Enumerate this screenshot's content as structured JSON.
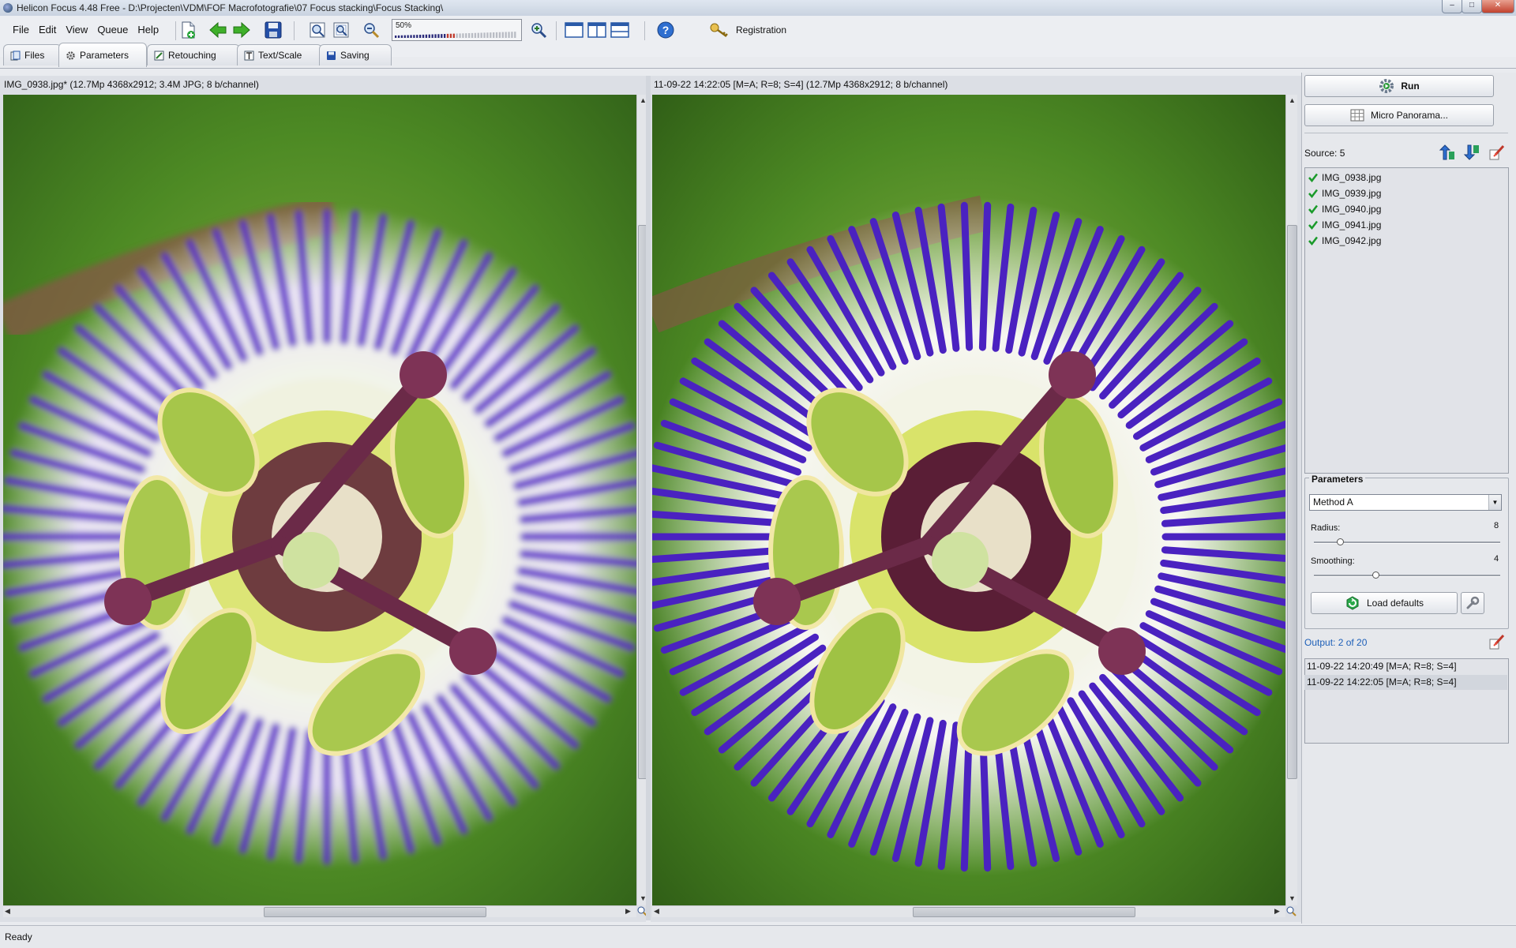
{
  "window": {
    "title": "Helicon Focus 4.48 Free - D:\\Projecten\\VDM\\FOF Macrofotografie\\07 Focus stacking\\Focus Stacking\\"
  },
  "menu": [
    "File",
    "Edit",
    "View",
    "Queue",
    "Help"
  ],
  "toolbar": {
    "zoom_value": "50%",
    "zoom_fraction": 0.5,
    "registration_label": "Registration"
  },
  "tabs": [
    {
      "label": "Files",
      "icon": "files-icon"
    },
    {
      "label": "Parameters",
      "icon": "gear-icon",
      "active": true
    },
    {
      "label": "Retouching",
      "icon": "brush-icon"
    },
    {
      "label": "Text/Scale",
      "icon": "text-icon"
    },
    {
      "label": "Saving",
      "icon": "save-icon"
    }
  ],
  "left_pane": {
    "header": "IMG_0938.jpg* (12.7Mp 4368x2912; 3.4M JPG; 8 b/channel)"
  },
  "right_pane": {
    "header": "11-09-22 14:22:05 [M=A; R=8; S=4] (12.7Mp 4368x2912; 8 b/channel)"
  },
  "side_panel": {
    "run_label": "Run",
    "micro_panorama_label": "Micro Panorama...",
    "source_label": "Source: 5",
    "sources": [
      "IMG_0938.jpg",
      "IMG_0939.jpg",
      "IMG_0940.jpg",
      "IMG_0941.jpg",
      "IMG_0942.jpg"
    ],
    "parameters_title": "Parameters",
    "method_value": "Method A",
    "radius_label": "Radius:",
    "radius_value": "8",
    "smoothing_label": "Smoothing:",
    "smoothing_value": "4",
    "load_defaults_label": "Load defaults",
    "output_label": "Output: 2 of 20",
    "outputs": [
      "11-09-22 14:20:49 [M=A; R=8; S=4]",
      "11-09-22 14:22:05 [M=A; R=8; S=4]"
    ]
  },
  "status": {
    "text": "Ready"
  },
  "colors": {
    "accent": "#1d5fb8",
    "check": "#1a9a2a",
    "petal_purple": "#5a2fc8",
    "foliage_green": "#3f8a22"
  }
}
